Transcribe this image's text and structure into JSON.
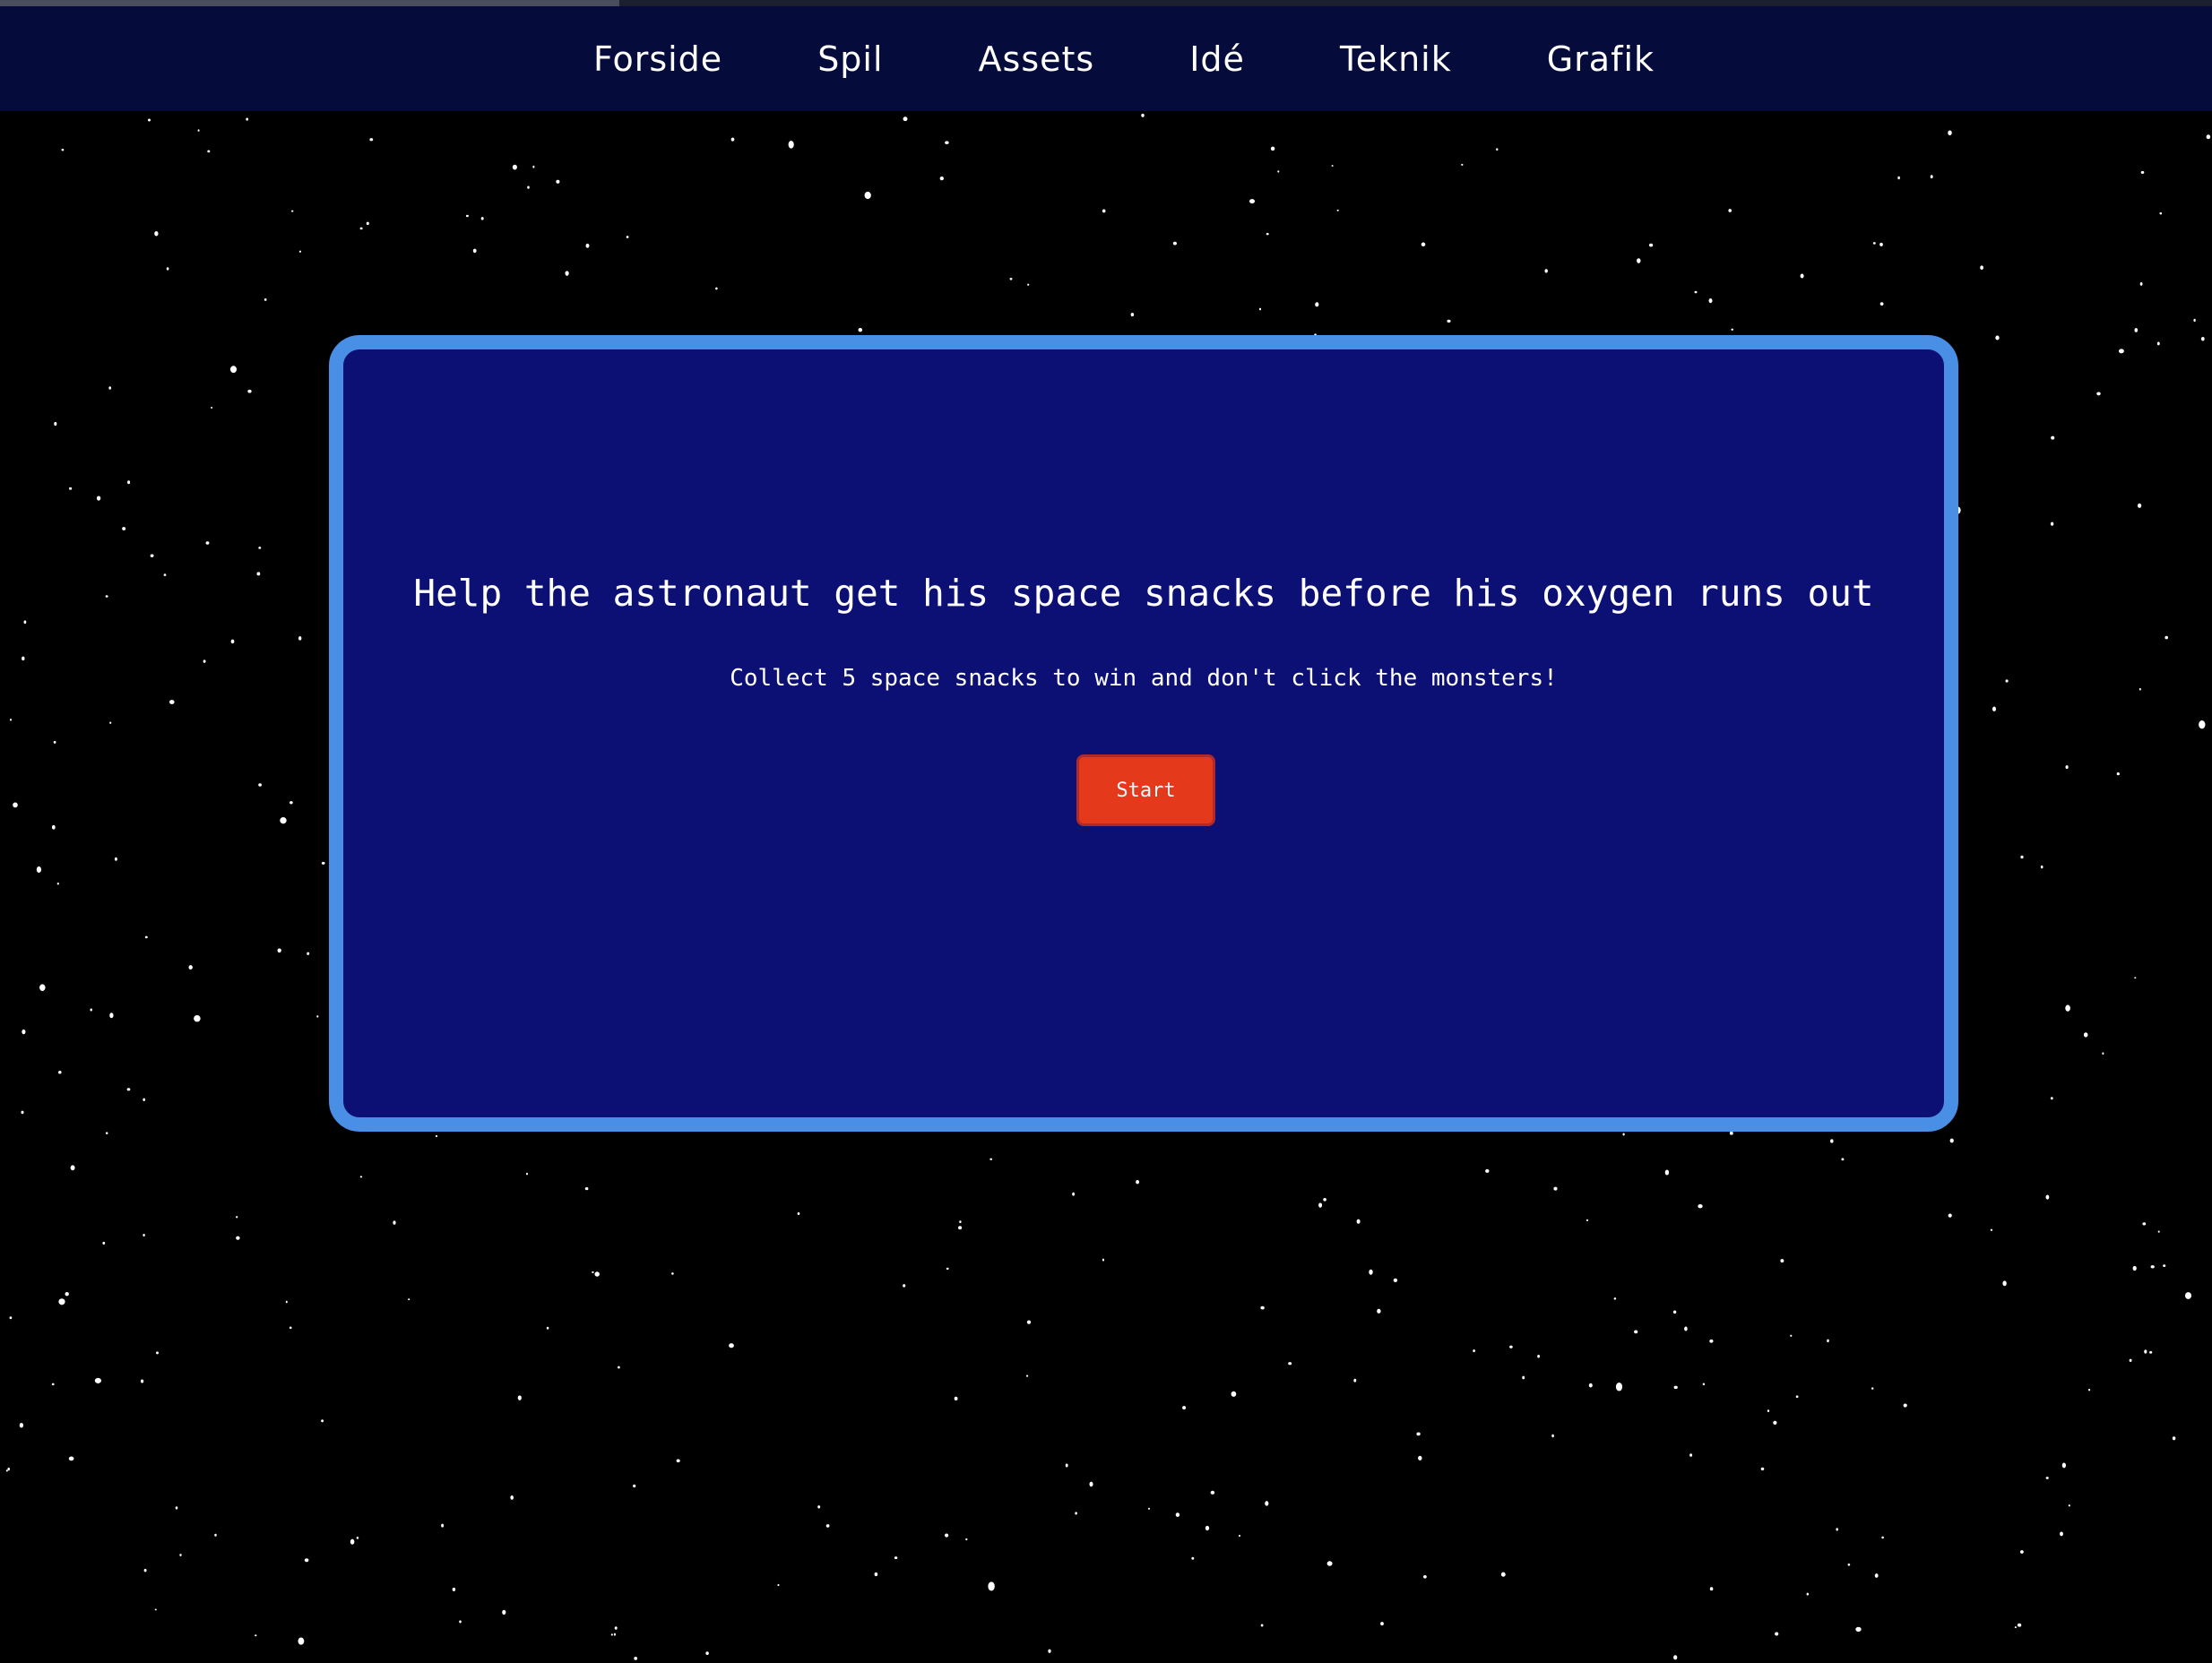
{
  "nav": {
    "items": [
      {
        "label": "Forside"
      },
      {
        "label": "Spil"
      },
      {
        "label": "Assets"
      },
      {
        "label": "Idé"
      },
      {
        "label": "Teknik"
      },
      {
        "label": "Grafik"
      }
    ]
  },
  "game": {
    "title": "Help the astronaut get his space snacks before his oxygen runs out",
    "instructions": "Collect 5 space snacks to win and don't click the monsters!",
    "start_label": "Start"
  },
  "page_load_progress": 0.28,
  "colors": {
    "background": "#000000",
    "navbar": "#050c3c",
    "panel": "#0c1075",
    "panel_border": "#4a8fe6",
    "start_button": "#e5391c",
    "text": "#ffffff",
    "star": "#ffffff"
  }
}
